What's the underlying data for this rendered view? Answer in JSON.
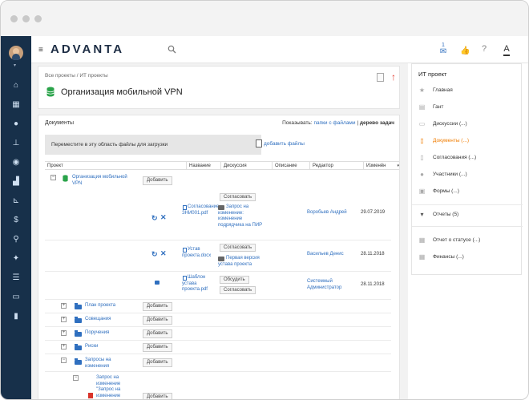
{
  "app": {
    "logo_text": "ADVANTA",
    "notification_count": "1"
  },
  "breadcrumb": {
    "text": "Все проекты / ИТ проекты"
  },
  "project": {
    "title": "Организация мобильной VPN"
  },
  "documents": {
    "title": "Документы",
    "show_label": "Показывать:",
    "show_files": "папки с файлами",
    "separator": "|",
    "show_tree": "дерево задач",
    "drop_zone": "Переместите в эту область файлы для загрузки",
    "add_files": "добавить файлы",
    "columns": [
      "Проект",
      "Название",
      "Дискуссия",
      "Описание",
      "Редактор",
      "Изменён"
    ],
    "root": {
      "label": "Организация мобильной VPN",
      "add": "Добавить"
    },
    "files": [
      {
        "name": "Согласование ЗНИ001.pdf",
        "action_approve": "Согласовать",
        "discussion": "Запрос на изменение: изменение подрядчика на ПИР",
        "editor": "Воробьев Андрей",
        "date": "29.07.2019"
      },
      {
        "name": "Устав проекта.docx",
        "action_approve": "Согласовать",
        "discussion": "Первая версия устава проекта",
        "editor": "Васильев Денис",
        "date": "28.11.2018"
      },
      {
        "name": "Шаблон устава проекта.pdf",
        "action_discuss": "Обсудить",
        "action_approve": "Согласовать",
        "editor": "Системный Администратор",
        "date": "28.11.2018"
      }
    ],
    "folders": [
      {
        "label": "План проекта",
        "add": "Добавить"
      },
      {
        "label": "Совещания",
        "add": "Добавить"
      },
      {
        "label": "Поручения",
        "add": "Добавить"
      },
      {
        "label": "Риски",
        "add": "Добавить"
      },
      {
        "label": "Запросы на изменения",
        "add": "Добавить"
      }
    ],
    "subfolder": {
      "label": "Запрос на изменение \"Запрос на изменение",
      "add": "Добавить"
    }
  },
  "right_panel": {
    "title": "ИТ проект",
    "items": [
      {
        "label": "Главная",
        "icon": "star-icon"
      },
      {
        "label": "Гант",
        "icon": "gantt-icon"
      },
      {
        "label": "Дискуссии (...)",
        "icon": "chat-icon"
      },
      {
        "label": "Документы (...)",
        "icon": "doc-icon",
        "active": true
      },
      {
        "label": "Согласования (...)",
        "icon": "approval-icon"
      },
      {
        "label": "Участники (...)",
        "icon": "users-icon"
      },
      {
        "label": "Формы (...)",
        "icon": "form-icon"
      }
    ],
    "reports": {
      "label": "Отчеты (5)"
    },
    "report_items": [
      {
        "label": "Отчет о статусе (...)"
      },
      {
        "label": "Финансы (...)"
      }
    ],
    "accent": "#f07c00"
  }
}
